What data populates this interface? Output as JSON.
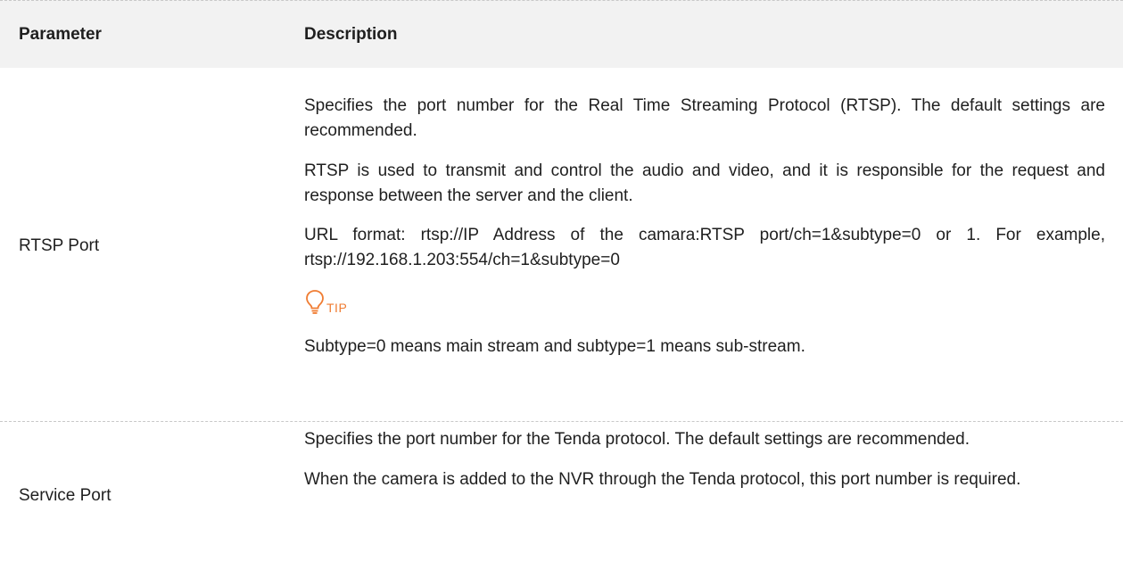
{
  "table": {
    "header": {
      "parameter": "Parameter",
      "description": "Description"
    },
    "rows": [
      {
        "parameter": "RTSP Port",
        "paragraphs": [
          "Specifies the port number for the Real Time Streaming Protocol (RTSP). The default settings are recommended.",
          "RTSP is used to transmit and control the audio and video, and it is responsible for the request and response between the server and the client.",
          "URL format: rtsp://IP Address of the camara:RTSP port/ch=1&subtype=0 or 1. For example, rtsp://192.168.1.203:554/ch=1&subtype=0"
        ],
        "tip": {
          "icon": "lightbulb-icon",
          "label": "TIP",
          "color": "#f07c32",
          "text": "Subtype=0 means main stream and subtype=1 means sub-stream."
        }
      },
      {
        "parameter": "Service Port",
        "paragraphs": [
          "Specifies the port number for the Tenda protocol. The default settings are recommended.",
          "When the camera is added to the NVR through the Tenda protocol, this port number is required."
        ]
      }
    ]
  }
}
